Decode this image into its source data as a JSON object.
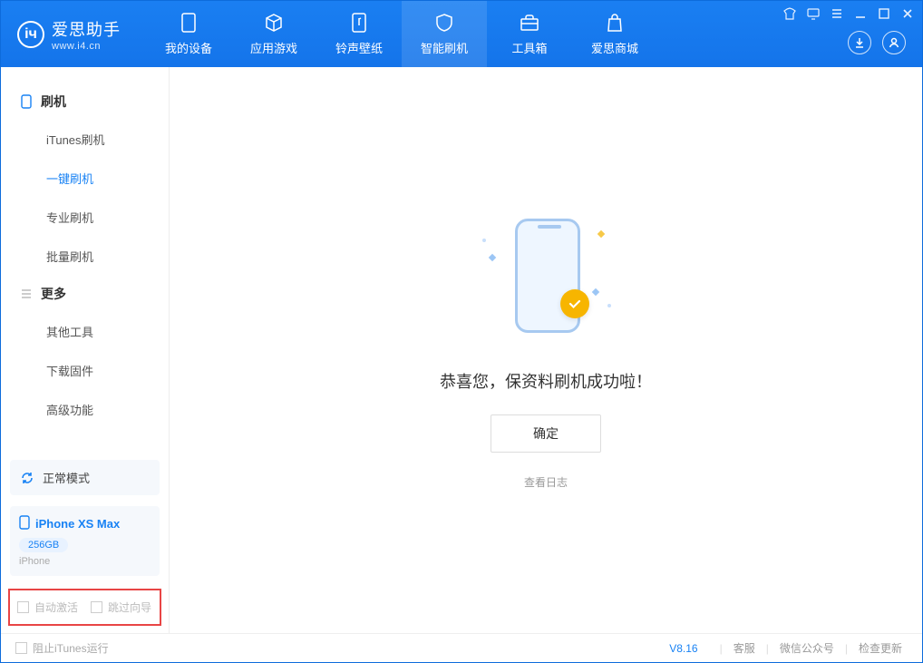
{
  "brand": {
    "name": "爱思助手",
    "url": "www.i4.cn"
  },
  "top_tabs": {
    "device": "我的设备",
    "apps": "应用游戏",
    "ringtones": "铃声壁纸",
    "flash": "智能刷机",
    "toolbox": "工具箱",
    "store": "爱思商城"
  },
  "sidebar": {
    "cat_flash": "刷机",
    "items_flash": {
      "itunes": "iTunes刷机",
      "oneclick": "一键刷机",
      "pro": "专业刷机",
      "batch": "批量刷机"
    },
    "cat_more": "更多",
    "items_more": {
      "other": "其他工具",
      "firmware": "下载固件",
      "advanced": "高级功能"
    }
  },
  "mode": {
    "label": "正常模式"
  },
  "device": {
    "name": "iPhone XS Max",
    "storage": "256GB",
    "type": "iPhone"
  },
  "checks": {
    "auto_activate": "自动激活",
    "skip_guide": "跳过向导"
  },
  "main": {
    "success": "恭喜您，保资料刷机成功啦！",
    "ok": "确定",
    "view_log": "查看日志"
  },
  "footer": {
    "block_itunes": "阻止iTunes运行",
    "version": "V8.16",
    "support": "客服",
    "wechat": "微信公众号",
    "update": "检查更新"
  }
}
